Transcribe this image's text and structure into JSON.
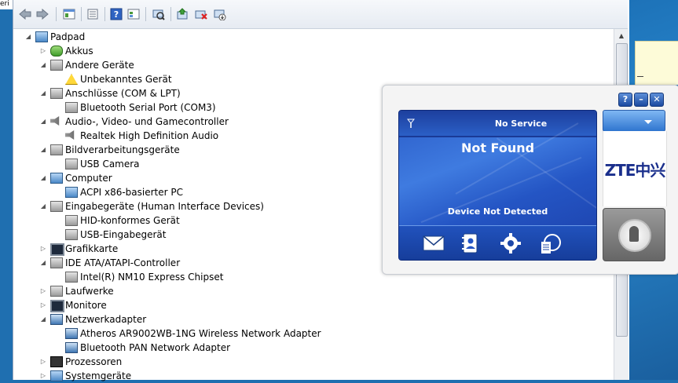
{
  "corner_fragment": "eri",
  "toolbar": {
    "buttons": [
      "back-icon",
      "forward-icon",
      "properties-icon",
      "details-icon",
      "help-icon",
      "view-icon",
      "scan-icon",
      "update-icon",
      "uninstall-icon",
      "disable-icon"
    ]
  },
  "tree": {
    "root": "Padpad",
    "items": [
      {
        "label": "Akkus",
        "level": 1,
        "expanded": false
      },
      {
        "label": "Andere Geräte",
        "level": 1,
        "expanded": true
      },
      {
        "label": "Unbekanntes Gerät",
        "level": 2
      },
      {
        "label": "Anschlüsse (COM & LPT)",
        "level": 1,
        "expanded": true
      },
      {
        "label": "Bluetooth Serial Port (COM3)",
        "level": 2
      },
      {
        "label": "Audio-, Video- und Gamecontroller",
        "level": 1,
        "expanded": true
      },
      {
        "label": "Realtek High Definition Audio",
        "level": 2
      },
      {
        "label": "Bildverarbeitungsgeräte",
        "level": 1,
        "expanded": true
      },
      {
        "label": "USB Camera",
        "level": 2
      },
      {
        "label": "Computer",
        "level": 1,
        "expanded": true
      },
      {
        "label": "ACPI x86-basierter PC",
        "level": 2
      },
      {
        "label": "Eingabegeräte (Human Interface Devices)",
        "level": 1,
        "expanded": true
      },
      {
        "label": "HID-konformes Gerät",
        "level": 2
      },
      {
        "label": "USB-Eingabegerät",
        "level": 2
      },
      {
        "label": "Grafikkarte",
        "level": 1,
        "expanded": false
      },
      {
        "label": "IDE ATA/ATAPI-Controller",
        "level": 1,
        "expanded": true
      },
      {
        "label": "Intel(R) NM10 Express Chipset",
        "level": 2
      },
      {
        "label": "Laufwerke",
        "level": 1,
        "expanded": false
      },
      {
        "label": "Monitore",
        "level": 1,
        "expanded": false
      },
      {
        "label": "Netzwerkadapter",
        "level": 1,
        "expanded": true
      },
      {
        "label": "Atheros AR9002WB-1NG Wireless Network Adapter",
        "level": 2
      },
      {
        "label": "Bluetooth PAN Network Adapter",
        "level": 2
      },
      {
        "label": "Prozessoren",
        "level": 1,
        "expanded": false
      },
      {
        "label": "Systemgeräte",
        "level": 1,
        "expanded": false
      }
    ]
  },
  "zte": {
    "service": "No Service",
    "status": "Not Found",
    "detect": "Device Not Detected",
    "logo": "ZTE中兴",
    "controls": {
      "help": "?",
      "minimize": "–",
      "close": "✕"
    }
  }
}
